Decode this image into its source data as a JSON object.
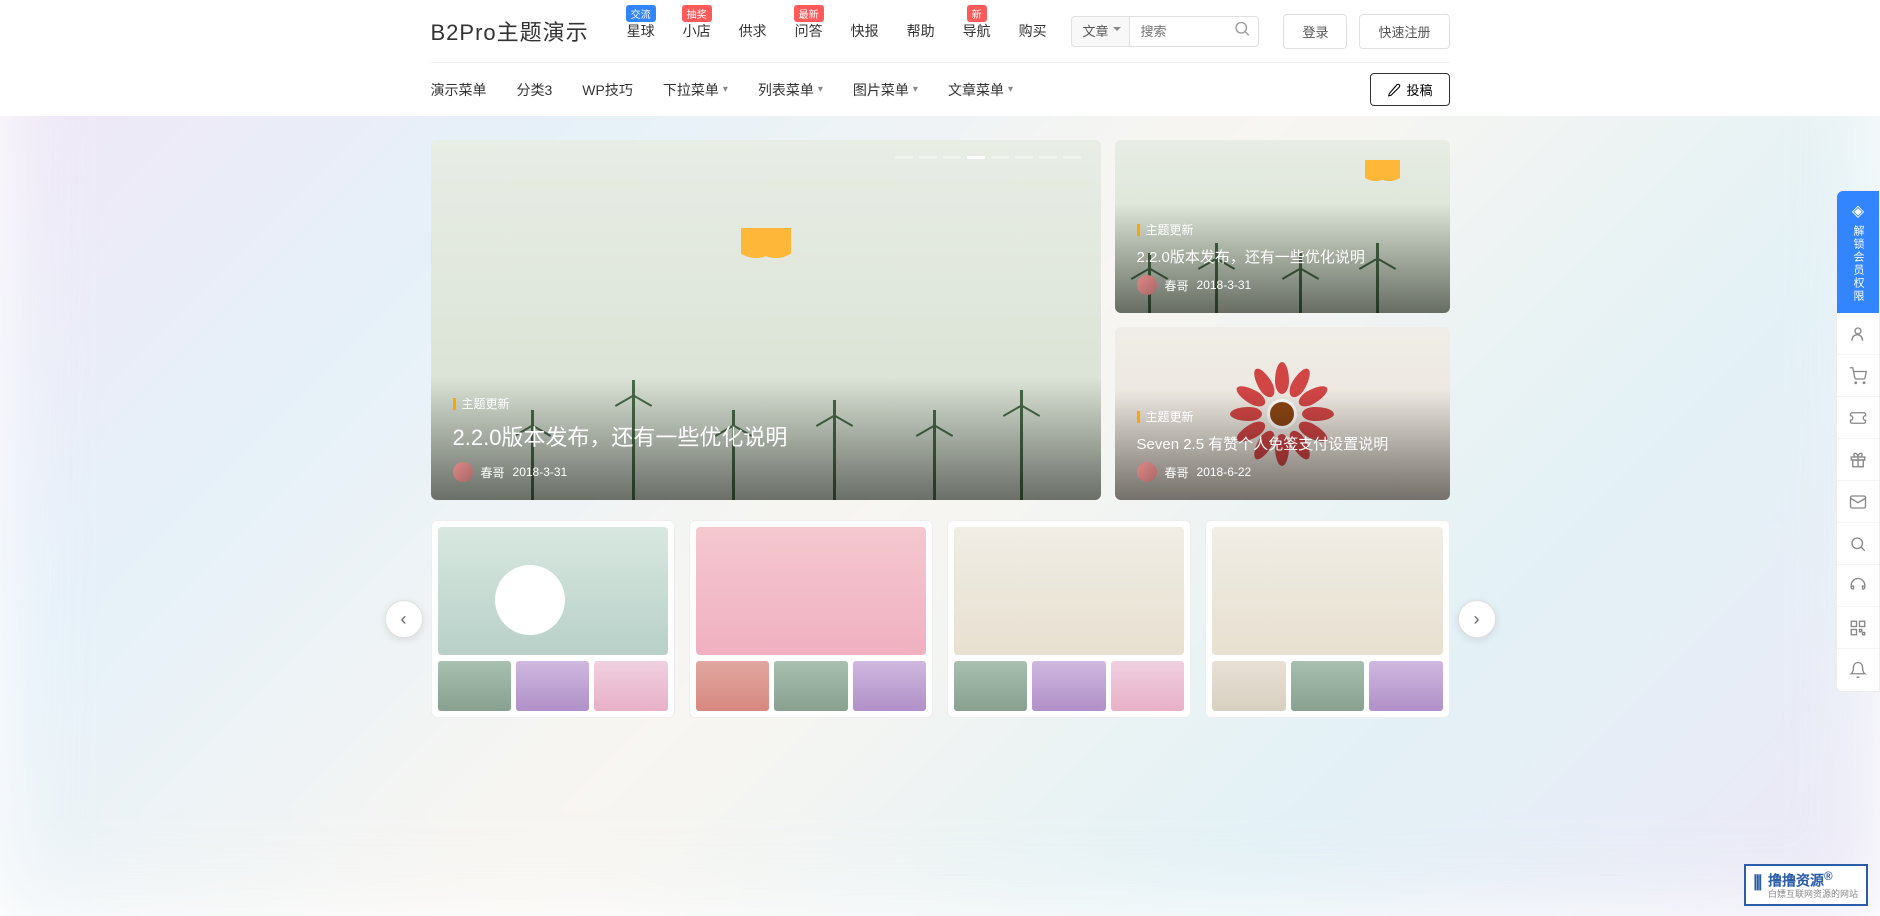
{
  "logo": "B2Pro主题演示",
  "nav": [
    {
      "label": "星球",
      "badge": "交流",
      "badge_color": "blue"
    },
    {
      "label": "小店",
      "badge": "抽奖",
      "badge_color": "red"
    },
    {
      "label": "供求"
    },
    {
      "label": "问答",
      "badge": "最新",
      "badge_color": "red"
    },
    {
      "label": "快报"
    },
    {
      "label": "帮助"
    },
    {
      "label": "导航",
      "badge": "新",
      "badge_color": "red"
    },
    {
      "label": "购买"
    }
  ],
  "search": {
    "select": "文章",
    "placeholder": "搜索"
  },
  "auth": {
    "login": "登录",
    "register": "快速注册"
  },
  "subnav": [
    {
      "label": "演示菜单"
    },
    {
      "label": "分类3"
    },
    {
      "label": "WP技巧"
    },
    {
      "label": "下拉菜单",
      "dropdown": true
    },
    {
      "label": "列表菜单",
      "dropdown": true
    },
    {
      "label": "图片菜单",
      "dropdown": true
    },
    {
      "label": "文章菜单",
      "dropdown": true
    }
  ],
  "post_btn": "投稿",
  "hero": {
    "category": "主题更新",
    "title": "2.2.0版本发布，还有一些优化说明",
    "author": "春哥",
    "date": "2018-3-31"
  },
  "side_cards": [
    {
      "category": "主题更新",
      "title": "2.2.0版本发布，还有一些优化说明",
      "author": "春哥",
      "date": "2018-3-31"
    },
    {
      "category": "主题更新",
      "title": "Seven 2.5 有赞个人免签支付设置说明",
      "author": "春哥",
      "date": "2018-6-22"
    }
  ],
  "right_bar_vip": "解锁会员权限",
  "watermark": {
    "title": "撸撸资源",
    "subtitle": "白嫖互联网资源的网站",
    "reg": "®"
  }
}
